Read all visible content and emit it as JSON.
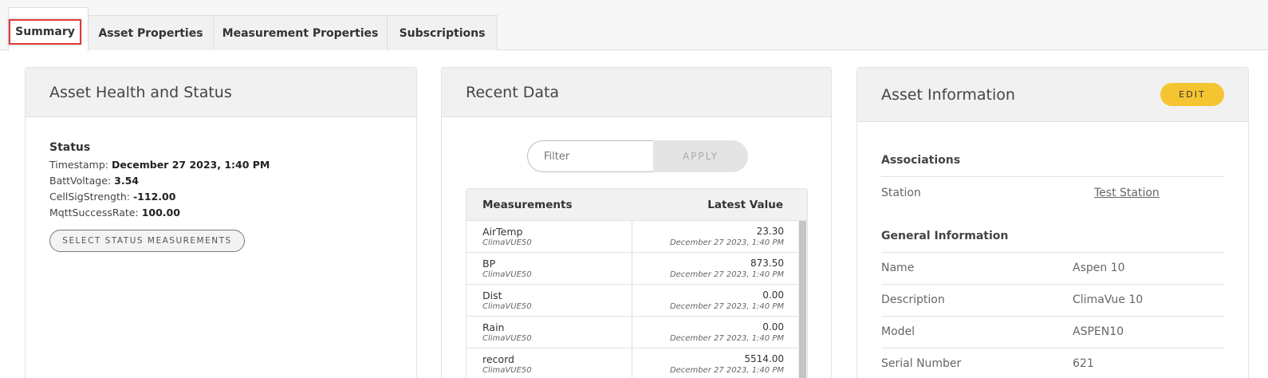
{
  "tabs": [
    {
      "label": "Summary",
      "active": true
    },
    {
      "label": "Asset Properties"
    },
    {
      "label": "Measurement Properties"
    },
    {
      "label": "Subscriptions"
    }
  ],
  "health": {
    "title": "Asset Health and Status",
    "status_heading": "Status",
    "lines": [
      {
        "label": "Timestamp:",
        "value": "December 27 2023, 1:40 PM"
      },
      {
        "label": "BattVoltage:",
        "value": "3.54"
      },
      {
        "label": "CellSigStrength:",
        "value": "-112.00"
      },
      {
        "label": "MqttSuccessRate:",
        "value": "100.00"
      }
    ],
    "select_button": "SELECT STATUS MEASUREMENTS"
  },
  "recent": {
    "title": "Recent Data",
    "filter_placeholder": "Filter",
    "apply_label": "APPLY",
    "col_measurements": "Measurements",
    "col_latest": "Latest Value",
    "rows": [
      {
        "name": "AirTemp",
        "source": "ClimaVUE50",
        "value": "23.30",
        "time": "December 27 2023, 1:40 PM"
      },
      {
        "name": "BP",
        "source": "ClimaVUE50",
        "value": "873.50",
        "time": "December 27 2023, 1:40 PM"
      },
      {
        "name": "Dist",
        "source": "ClimaVUE50",
        "value": "0.00",
        "time": "December 27 2023, 1:40 PM"
      },
      {
        "name": "Rain",
        "source": "ClimaVUE50",
        "value": "0.00",
        "time": "December 27 2023, 1:40 PM"
      },
      {
        "name": "record",
        "source": "ClimaVUE50",
        "value": "5514.00",
        "time": "December 27 2023, 1:40 PM"
      }
    ]
  },
  "info": {
    "title": "Asset Information",
    "edit_label": "EDIT",
    "associations_heading": "Associations",
    "station_label": "Station",
    "station_value": "Test Station",
    "general_heading": "General Information",
    "fields": [
      {
        "label": "Name",
        "value": "Aspen 10"
      },
      {
        "label": "Description",
        "value": "ClimaVue 10"
      },
      {
        "label": "Model",
        "value": "ASPEN10"
      },
      {
        "label": "Serial Number",
        "value": "621"
      }
    ]
  },
  "colors": {
    "edit_button": "#f5c431",
    "tab_highlight": "#e23a3a"
  }
}
